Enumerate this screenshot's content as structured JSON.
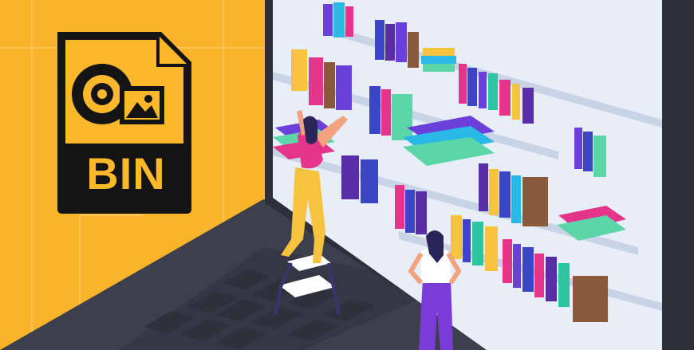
{
  "bin_icon": {
    "label": "BIN",
    "icons": [
      "disc-icon",
      "image-icon"
    ]
  },
  "colors": {
    "background": "#FBB82B",
    "background_light": "#FCC94D",
    "icon_dark": "#141414",
    "laptop_body": "#3E3F4D",
    "keyboard_key": "#2F303C",
    "screen": "#E8EEF8",
    "shelf": "#C9D3E6",
    "shirt": "#E5358B",
    "pants_yellow": "#F6C33E",
    "pants_purple": "#7A3BD9"
  }
}
